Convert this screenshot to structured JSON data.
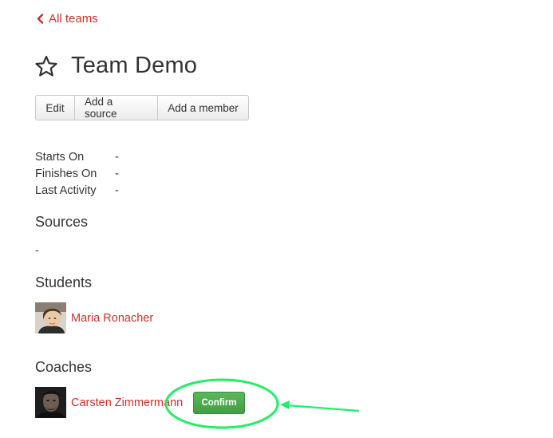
{
  "nav": {
    "back_label": "All teams",
    "back_icon": "chevron-left-icon"
  },
  "team": {
    "title": "Team Demo",
    "star_icon": "star-outline-icon"
  },
  "actions": {
    "edit_label": "Edit",
    "add_source_label": "Add a source",
    "add_member_label": "Add a member"
  },
  "meta": {
    "rows": [
      {
        "label": "Starts On",
        "value": "-"
      },
      {
        "label": "Finishes On",
        "value": "-"
      },
      {
        "label": "Last Activity",
        "value": "-"
      }
    ]
  },
  "sources": {
    "heading": "Sources",
    "value": "-"
  },
  "students": {
    "heading": "Students",
    "items": [
      {
        "name": "Maria Ronacher"
      }
    ]
  },
  "coaches": {
    "heading": "Coaches",
    "items": [
      {
        "name": "Carsten Zimmermann",
        "confirm_label": "Confirm"
      }
    ]
  },
  "colors": {
    "link": "#c9302c",
    "confirm": "#4cae4c",
    "annotation": "#22ee66"
  }
}
